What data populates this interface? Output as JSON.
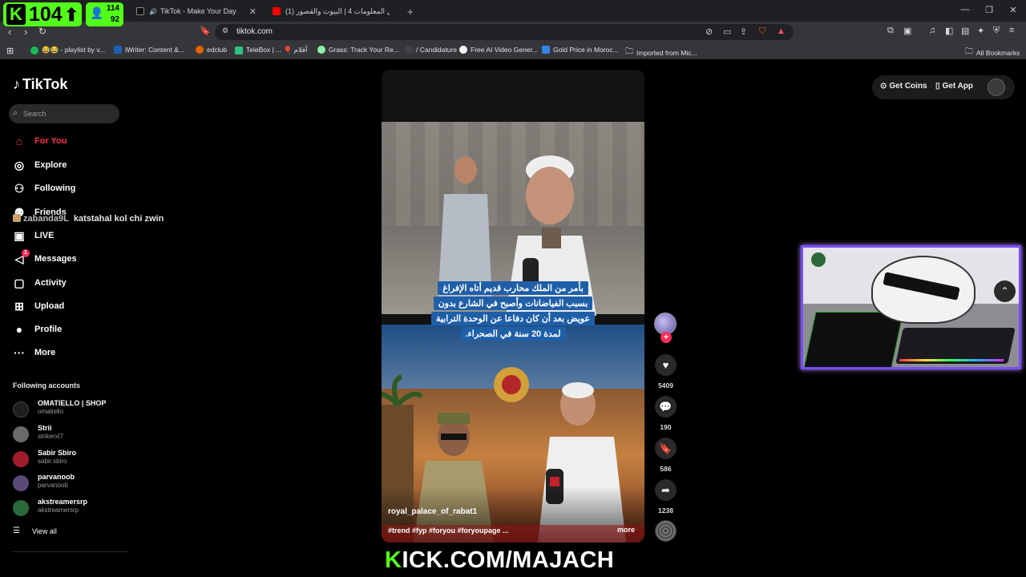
{
  "browser": {
    "tabs": [
      {
        "label": "TikTok - Make Your Day",
        "favicon_color": "#111111",
        "active": true
      },
      {
        "label": "تحدي المعلومات 4 | البيوت والقصور (1)",
        "favicon_color": "#ff0000",
        "active": false
      }
    ],
    "url": "tiktok.com",
    "bookmarks": [
      {
        "label": "😂😂 - playlist by v...",
        "color": "#1db954"
      },
      {
        "label": "iWriter: Content &...",
        "color": "#1a5fb4"
      },
      {
        "label": "edclub",
        "color": "#e66100"
      },
      {
        "label": "TeleBox | ... 🎈 أفلام",
        "color": "#2ec27e"
      },
      {
        "label": "Grass: Track Your Re...",
        "color": "#8ff0a4"
      },
      {
        "label": "/ Candidature",
        "color": "#444444"
      },
      {
        "label": "Free AI Video Gener...",
        "color": "#f6f5f4"
      },
      {
        "label": "Gold Price in Moroc...",
        "color": "#3584e4"
      },
      {
        "label": "Imported from Mic...",
        "color": "#999999"
      }
    ],
    "all_bookmarks": "All Bookmarks"
  },
  "overlay": {
    "kick_count": "104",
    "stat_a": "114",
    "stat_b": "92",
    "chat_user": "zabanda9L",
    "chat_msg": "katstahal kol chi zwin",
    "footer_k": "K",
    "footer_rest": "ICK.COM/MAJACH"
  },
  "sidebar": {
    "brand": "TikTok",
    "search_placeholder": "Search",
    "nav": [
      {
        "label": "For You",
        "icon": "home-icon"
      },
      {
        "label": "Explore",
        "icon": "compass-icon"
      },
      {
        "label": "Following",
        "icon": "user-plus-icon"
      },
      {
        "label": "Friends",
        "icon": "friends-icon"
      },
      {
        "label": "LIVE",
        "icon": "live-icon"
      },
      {
        "label": "Messages",
        "icon": "send-icon",
        "badge": "1"
      },
      {
        "label": "Activity",
        "icon": "chat-icon"
      },
      {
        "label": "Upload",
        "icon": "plus-square-icon"
      },
      {
        "label": "Profile",
        "icon": "profile-icon"
      },
      {
        "label": "More",
        "icon": "more-icon"
      }
    ],
    "following_title": "Following accounts",
    "accounts": [
      {
        "name": "OMATIELLO | SHOP",
        "handle": "omatiello",
        "color": "#1e1e1e"
      },
      {
        "name": "Strii",
        "handle": "strikerxl7",
        "color": "#6a6a6a"
      },
      {
        "name": "Sabir Sbiro",
        "handle": "sabir.sbiro",
        "color": "#a01c2c"
      },
      {
        "name": "parvanoob",
        "handle": "parvanoob",
        "color": "#5a4a7a"
      },
      {
        "name": "akstreamersrp",
        "handle": "akstreamersrp",
        "color": "#2a6a3a"
      }
    ],
    "view_all": "View all"
  },
  "video": {
    "caption_lines": [
      "بأمر من الملك محارب قديم أتاه الإفراغ",
      "بسبب الفياضانات وأصبح في الشارع بدون",
      "عويض بعد أن كان دفاعا عن الوحدة الترابية",
      "لمدة 20 سنة في الصحراء."
    ],
    "username": "royal_palace_of_rabat1",
    "tags": "#trend #fyp #foryou #foryoupage ...",
    "more": "more",
    "likes": "5409",
    "comments": "190",
    "saves": "586",
    "shares": "1238"
  },
  "topbar": {
    "get_coins": "Get Coins",
    "get_app": "Get App"
  },
  "colors": {
    "accent": "#fe2c55",
    "kick_green": "#53fc18"
  }
}
